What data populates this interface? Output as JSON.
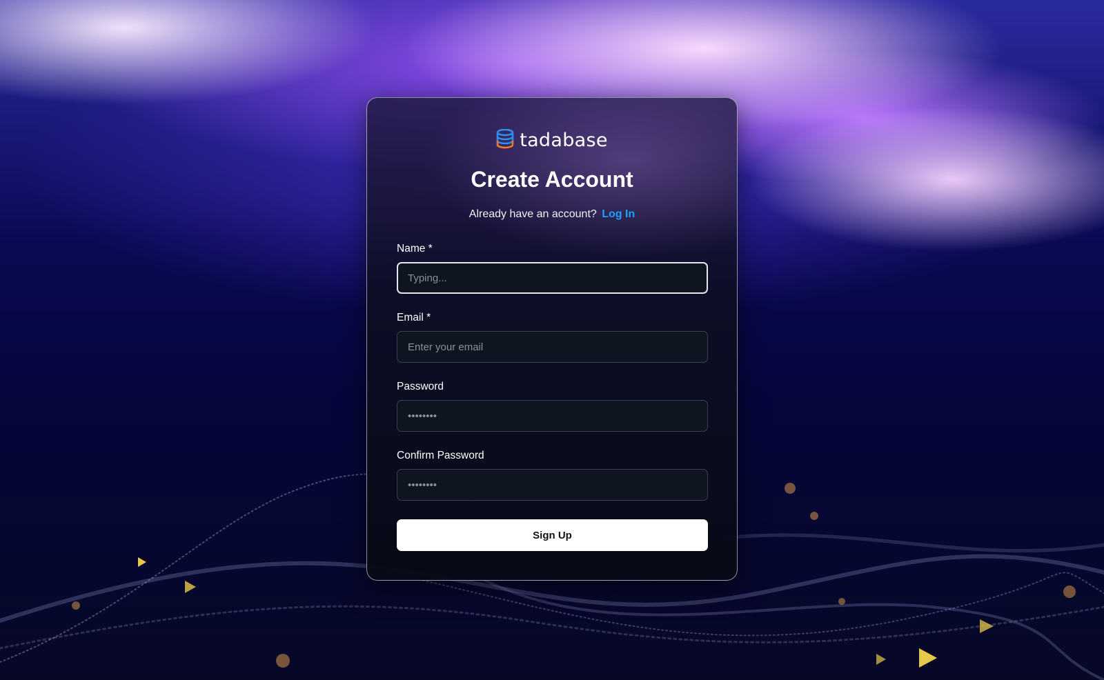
{
  "brand": {
    "name": "tadabase",
    "icon": "database-stack-icon",
    "colors": {
      "top": "#2d8ff0",
      "bottom": "#f07a2a"
    }
  },
  "header": {
    "title": "Create Account",
    "subtitle_text": "Already have an account?",
    "login_link": "Log In"
  },
  "form": {
    "name": {
      "label": "Name *",
      "placeholder": "Typing..."
    },
    "email": {
      "label": "Email *",
      "placeholder": "Enter your email"
    },
    "password": {
      "label": "Password",
      "placeholder": "••••••••"
    },
    "confirm_password": {
      "label": "Confirm Password",
      "placeholder": "••••••••"
    },
    "submit_label": "Sign Up"
  },
  "theme": {
    "accent": "#1aa3ff",
    "card_background": "#0f1421",
    "button_background": "#ffffff"
  }
}
